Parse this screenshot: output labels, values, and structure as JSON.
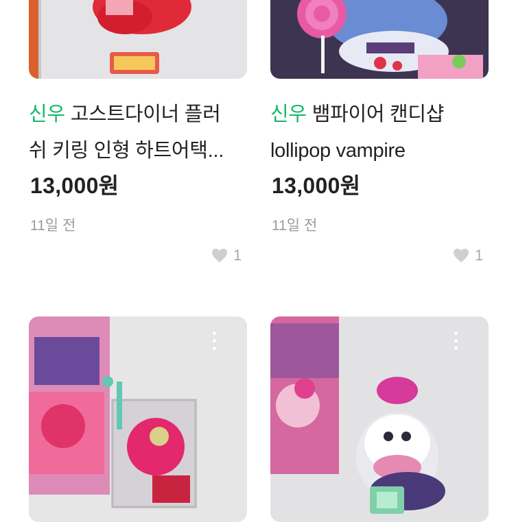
{
  "products": [
    {
      "shop": "신우",
      "title_line1": "고스트다이너 플러",
      "title_line2": "쉬 키링 인형 하트어택...",
      "price": "13,000원",
      "date": "11일 전",
      "likes": "1"
    },
    {
      "shop": "신우",
      "title_line1": "뱀파이어 캔디샵",
      "title_line2": "lollipop vampire",
      "price": "13,000원",
      "date": "11일 전",
      "likes": "1"
    }
  ],
  "icons": {
    "like": "heart-icon",
    "more": "more-vertical-icon"
  },
  "colors": {
    "shop": "#14b86b",
    "muted": "#9a9a9a"
  }
}
